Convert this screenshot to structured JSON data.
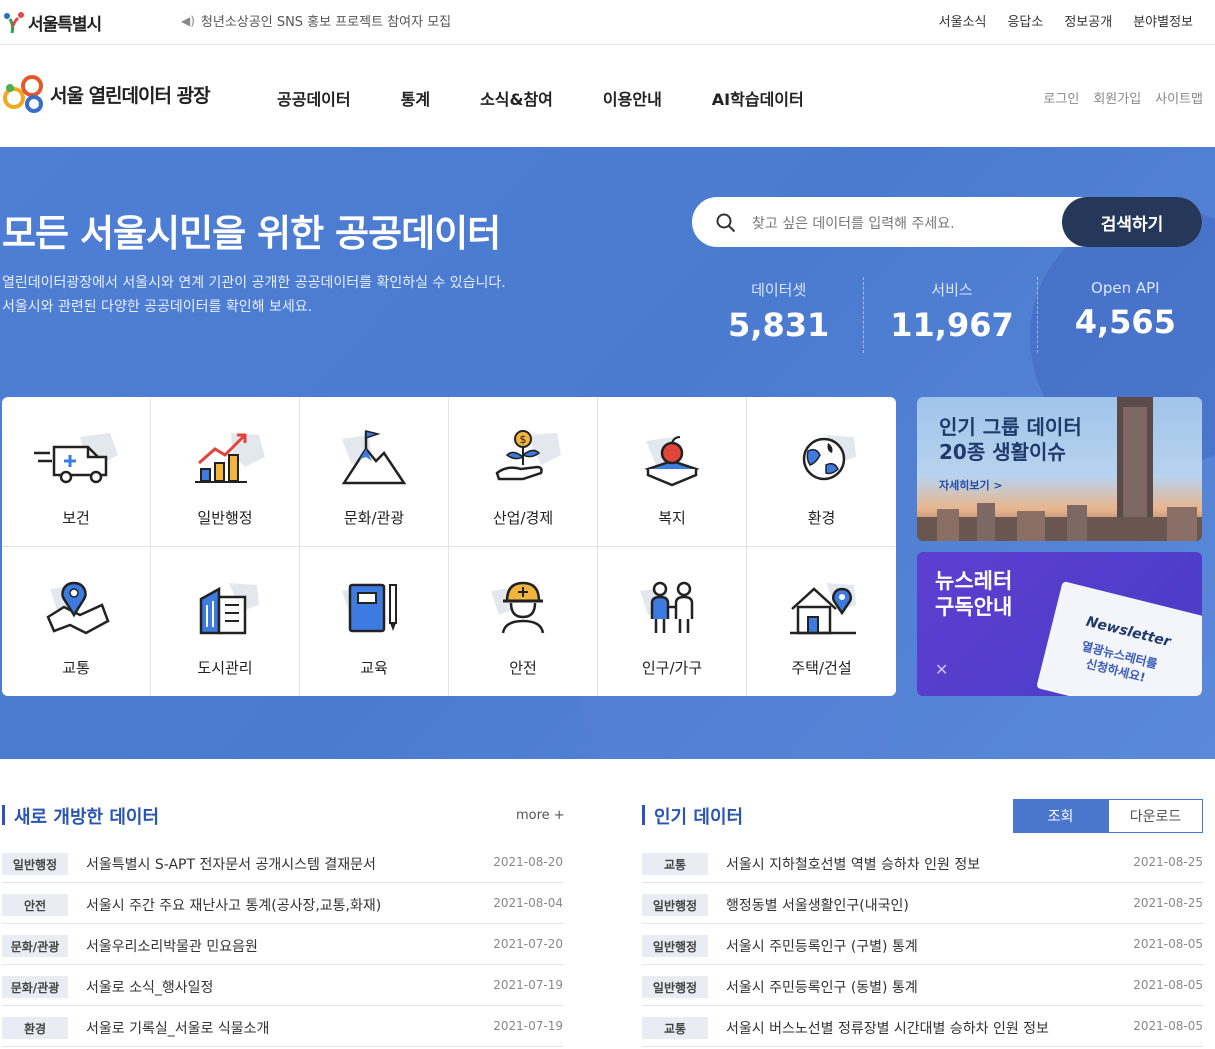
{
  "topbar": {
    "logo_text": "서울특별시",
    "notice": "청년소상공인 SNS 홍보 프로젝트 참여자 모집",
    "links": [
      "서울소식",
      "응답소",
      "정보공개",
      "분야별정보"
    ]
  },
  "header": {
    "brand": "서울 열린데이터 광장",
    "nav": [
      "공공데이터",
      "통계",
      "소식&참여",
      "이용안내",
      "AI학습데이터"
    ],
    "util": [
      "로그인",
      "회원가입",
      "사이트맵"
    ]
  },
  "hero": {
    "title": "모든 서울시민을 위한 공공데이터",
    "desc_line1": "열린데이터광장에서 서울시와 연계 기관이 공개한 공공데이터를 확인하실 수 있습니다.",
    "desc_line2": "서울시와 관련된 다양한 공공데이터를 확인해 보세요.",
    "search_placeholder": "찾고 싶은 데이터를 입력해 주세요.",
    "search_button": "검색하기",
    "stats": [
      {
        "label": "데이터셋",
        "value": "5,831"
      },
      {
        "label": "서비스",
        "value": "11,967"
      },
      {
        "label": "Open API",
        "value": "4,565"
      }
    ]
  },
  "categories": [
    {
      "label": "보건",
      "icon": "ambulance-icon"
    },
    {
      "label": "일반행정",
      "icon": "chart-up-icon"
    },
    {
      "label": "문화/관광",
      "icon": "mountain-flag-icon"
    },
    {
      "label": "산업/경제",
      "icon": "money-plant-icon"
    },
    {
      "label": "복지",
      "icon": "apple-book-icon"
    },
    {
      "label": "환경",
      "icon": "globe-leaf-icon"
    },
    {
      "label": "교통",
      "icon": "map-pin-icon"
    },
    {
      "label": "도시관리",
      "icon": "buildings-icon"
    },
    {
      "label": "교육",
      "icon": "notebook-pen-icon"
    },
    {
      "label": "안전",
      "icon": "helmet-worker-icon"
    },
    {
      "label": "인구/가구",
      "icon": "family-icon"
    },
    {
      "label": "주택/건설",
      "icon": "house-pin-icon"
    }
  ],
  "banners": {
    "popular_line1": "인기 그룹 데이터",
    "popular_line2": "20종 생활이슈",
    "popular_more": "자세히보기 >",
    "newsletter_line1": "뉴스레터",
    "newsletter_line2": "구독안내",
    "newsletter_card": "Newsletter",
    "newsletter_card_sub1": "열광뉴스레터를",
    "newsletter_card_sub2": "신청하세요!"
  },
  "new_data": {
    "title": "새로 개방한 데이터",
    "more": "more +",
    "rows": [
      {
        "badge": "일반행정",
        "title": "서울특별시 S-APT 전자문서 공개시스템 결재문서",
        "date": "2021-08-20"
      },
      {
        "badge": "안전",
        "title": "서울시 주간 주요 재난사고 통계(공사장,교통,화재)",
        "date": "2021-08-04"
      },
      {
        "badge": "문화/관광",
        "title": "서울우리소리박물관 민요음원",
        "date": "2021-07-20"
      },
      {
        "badge": "문화/관광",
        "title": "서울로 소식_행사일정",
        "date": "2021-07-19"
      },
      {
        "badge": "환경",
        "title": "서울로 기록실_서울로 식물소개",
        "date": "2021-07-19"
      }
    ]
  },
  "popular_data": {
    "title": "인기 데이터",
    "tab_views": "조회",
    "tab_downloads": "다운로드",
    "rows": [
      {
        "badge": "교통",
        "title": "서울시 지하철호선별 역별 승하차 인원 정보",
        "date": "2021-08-25"
      },
      {
        "badge": "일반행정",
        "title": "행정동별 서울생활인구(내국인)",
        "date": "2021-08-25"
      },
      {
        "badge": "일반행정",
        "title": "서울시 주민등록인구 (구별) 통계",
        "date": "2021-08-05"
      },
      {
        "badge": "일반행정",
        "title": "서울시 주민등록인구 (동별) 통계",
        "date": "2021-08-05"
      },
      {
        "badge": "교통",
        "title": "서울시 버스노선별 정류장별 시간대별 승하차 인원 정보",
        "date": "2021-08-05"
      }
    ]
  }
}
